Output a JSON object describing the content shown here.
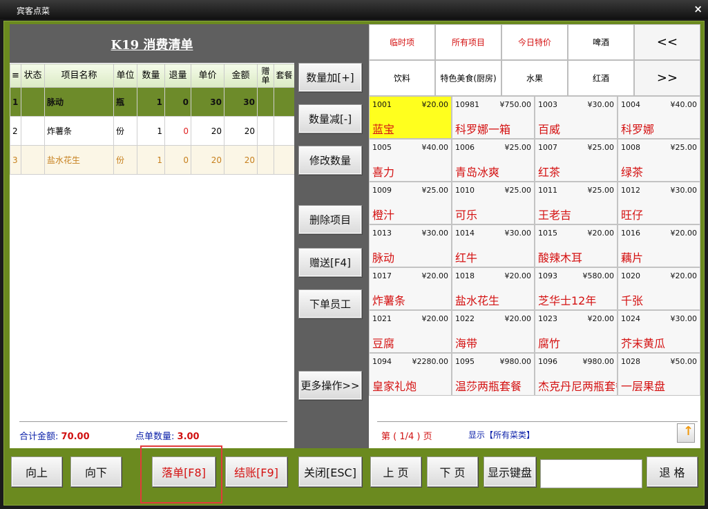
{
  "window": {
    "title": "宾客点菜",
    "close": "×"
  },
  "order": {
    "title": "K19  消费清单",
    "columns": [
      "≡",
      "状态",
      "项目名称",
      "单位",
      "数量",
      "退量",
      "单价",
      "金额",
      "赠单",
      "套餐"
    ],
    "rows": [
      {
        "idx": "1",
        "status": "",
        "name": "脉动",
        "unit": "瓶",
        "qty": "1",
        "ret": "0",
        "price": "30",
        "amount": "30",
        "gift": "",
        "set": ""
      },
      {
        "idx": "2",
        "status": "",
        "name": "炸薯条",
        "unit": "份",
        "qty": "1",
        "ret": "0",
        "price": "20",
        "amount": "20",
        "gift": "",
        "set": ""
      },
      {
        "idx": "3",
        "status": "",
        "name": "盐水花生",
        "unit": "份",
        "qty": "1",
        "ret": "0",
        "price": "20",
        "amount": "20",
        "gift": "",
        "set": ""
      }
    ],
    "total_label": "合计金额:",
    "total_value": "70.00",
    "count_label": "点单数量:",
    "count_value": "3.00"
  },
  "actions": {
    "qty_add": "数量加[+]",
    "qty_sub": "数量减[-]",
    "qty_edit": "修改数量",
    "delete": "删除项目",
    "gift": "赠送[F4]",
    "staff": "下单员工",
    "more": "更多操作>>"
  },
  "categories": {
    "row1": [
      "临时项",
      "所有项目",
      "今日特价",
      "啤酒",
      "<<"
    ],
    "row2": [
      "饮料",
      "特色美食(厨房)",
      "水果",
      "红酒",
      ">>"
    ]
  },
  "items": [
    {
      "code": "1001",
      "price": "¥20.00",
      "name": "蓝宝"
    },
    {
      "code": "10981",
      "price": "¥750.00",
      "name": "科罗娜一箱"
    },
    {
      "code": "1003",
      "price": "¥30.00",
      "name": "百威"
    },
    {
      "code": "1004",
      "price": "¥40.00",
      "name": "科罗娜"
    },
    {
      "code": "1005",
      "price": "¥40.00",
      "name": "喜力"
    },
    {
      "code": "1006",
      "price": "¥25.00",
      "name": "青岛冰爽"
    },
    {
      "code": "1007",
      "price": "¥25.00",
      "name": "红茶"
    },
    {
      "code": "1008",
      "price": "¥25.00",
      "name": "绿茶"
    },
    {
      "code": "1009",
      "price": "¥25.00",
      "name": "橙汁"
    },
    {
      "code": "1010",
      "price": "¥25.00",
      "name": "可乐"
    },
    {
      "code": "1011",
      "price": "¥25.00",
      "name": "王老吉"
    },
    {
      "code": "1012",
      "price": "¥30.00",
      "name": "旺仔"
    },
    {
      "code": "1013",
      "price": "¥30.00",
      "name": "脉动"
    },
    {
      "code": "1014",
      "price": "¥30.00",
      "name": "红牛"
    },
    {
      "code": "1015",
      "price": "¥20.00",
      "name": "酸辣木耳"
    },
    {
      "code": "1016",
      "price": "¥20.00",
      "name": "藕片"
    },
    {
      "code": "1017",
      "price": "¥20.00",
      "name": "炸薯条"
    },
    {
      "code": "1018",
      "price": "¥20.00",
      "name": "盐水花生"
    },
    {
      "code": "1093",
      "price": "¥580.00",
      "name": "芝华士12年"
    },
    {
      "code": "1020",
      "price": "¥20.00",
      "name": "千张"
    },
    {
      "code": "1021",
      "price": "¥20.00",
      "name": "豆腐"
    },
    {
      "code": "1022",
      "price": "¥20.00",
      "name": "海带"
    },
    {
      "code": "1023",
      "price": "¥20.00",
      "name": "腐竹"
    },
    {
      "code": "1024",
      "price": "¥30.00",
      "name": "芥末黄瓜"
    },
    {
      "code": "1094",
      "price": "¥2280.00",
      "name": "皇家礼炮"
    },
    {
      "code": "1095",
      "price": "¥980.00",
      "name": "温莎两瓶套餐"
    },
    {
      "code": "1096",
      "price": "¥980.00",
      "name": "杰克丹尼两瓶套餐"
    },
    {
      "code": "1028",
      "price": "¥50.00",
      "name": "一层果盘"
    }
  ],
  "pager": {
    "text": "第 ( 1/4 ) 页",
    "display": "显示【所有菜类】"
  },
  "bottom": {
    "up": "向上",
    "down": "向下",
    "place_order": "落单[F8]",
    "checkout": "结账[F9]",
    "close": "关闭[ESC]",
    "prev_page": "上 页",
    "next_page": "下 页",
    "keyboard": "显示键盘",
    "backspace": "退 格"
  },
  "colors": {
    "frame": "#6b8a1f",
    "selected_item": "#ffff1e",
    "item_name": "#d41111",
    "highlight_box": "#e23b3b"
  }
}
